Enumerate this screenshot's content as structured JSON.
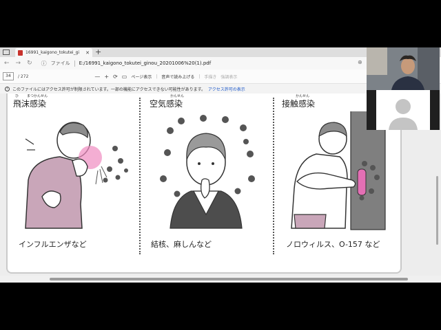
{
  "browser": {
    "tab_title": "16991_kaigono_tokutei_gi",
    "tab_close": "✕",
    "newtab": "+",
    "address_label": "ファイル",
    "address_url": "E:/16991_kaigono_tokutei_ginou_20201006%20(1).pdf"
  },
  "pdf_toolbar": {
    "page_current": "34",
    "page_total": "/ 272",
    "zoom_out": "—",
    "zoom_in": "+",
    "page_view": "ページ表示",
    "read_aloud": "音声で読み上げる",
    "draw": "手描き",
    "highlight": "強調表示"
  },
  "info_bar": {
    "message": "このファイルにはアクセス許可が制限されています。一部の機能にアクセスできない可能性があります。",
    "link": "アクセス許可の表示"
  },
  "document": {
    "panels": [
      {
        "ruby1": "ひ",
        "ruby2": "まつかんせん",
        "heading": "飛沫感染",
        "caption": "インフルエンザなど"
      },
      {
        "ruby1": "",
        "ruby2": "かんせん",
        "heading": "空気感染",
        "caption": "結核、麻しんなど"
      },
      {
        "ruby1": "",
        "ruby2": "かんせん",
        "heading": "接触感染",
        "caption": "ノロウィルス、O-157 など"
      }
    ]
  },
  "icons": {
    "sidebar": "sidebar-icon",
    "pdf": "pdf-icon",
    "back": "back-icon",
    "forward": "forward-icon",
    "reload": "reload-icon",
    "info": "info-icon",
    "zoom": "zoom-icon",
    "rotate": "rotate-icon",
    "fit": "fit-page-icon"
  },
  "colors": {
    "link": "#1a56c8",
    "pdf_icon": "#c8322c",
    "cough_blush": "#f08cc0",
    "clothes": "#c9a6b9",
    "contact_dot": "#e36fb4"
  }
}
